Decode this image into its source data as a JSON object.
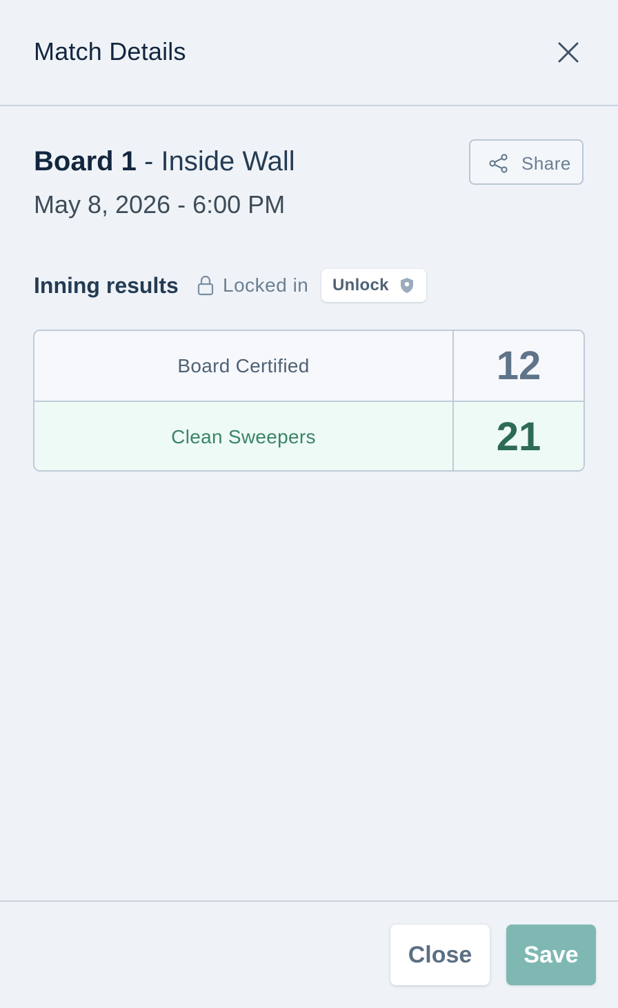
{
  "header": {
    "title": "Match Details",
    "close_icon": "close-icon"
  },
  "match": {
    "board_name": "Board 1",
    "separator": " - ",
    "location": "Inside Wall",
    "datetime": "May 8, 2026 - 6:00 PM",
    "share_label": "Share",
    "share_icon": "share-icon"
  },
  "results": {
    "title": "Inning results",
    "lock_icon": "lock-icon",
    "locked_text": "Locked in",
    "unlock_label": "Unlock",
    "unlock_icon": "shield-icon",
    "rows": [
      {
        "team": "Board Certified",
        "score": "12",
        "winner": false
      },
      {
        "team": "Clean Sweepers",
        "score": "21",
        "winner": true
      }
    ]
  },
  "footer": {
    "close_label": "Close",
    "save_label": "Save"
  },
  "colors": {
    "background": "#eff3f7",
    "winner_row": "#eefaf5",
    "winner_text": "#3a8468",
    "save_button": "#7fb8b2"
  }
}
